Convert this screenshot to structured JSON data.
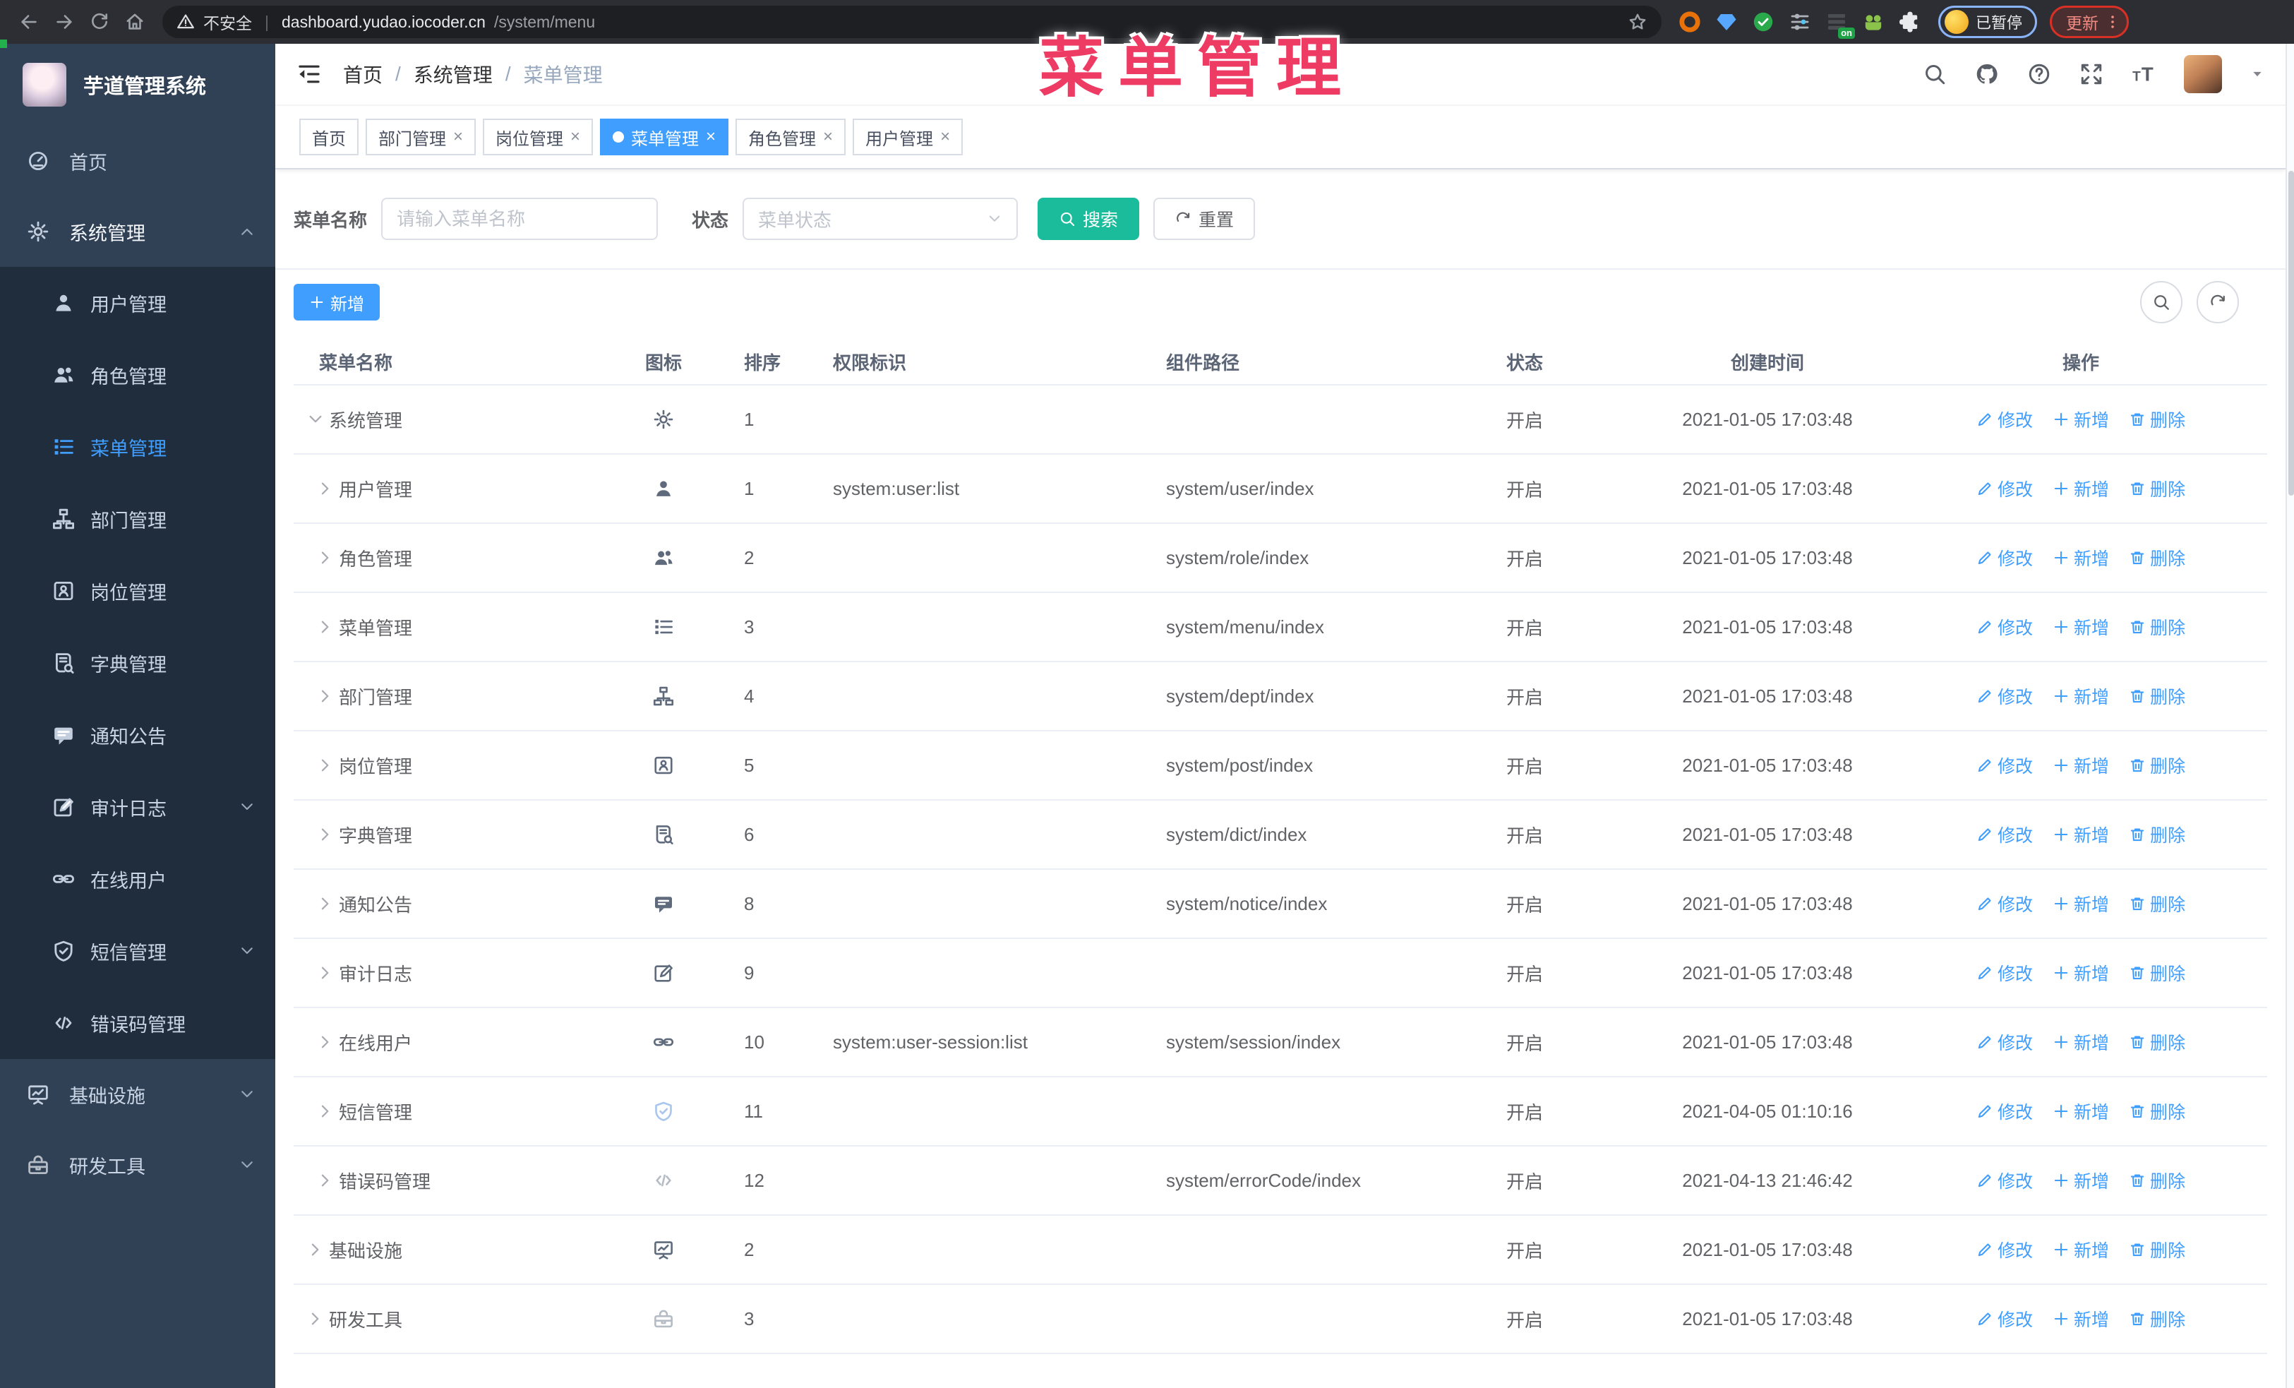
{
  "colors": {
    "accent": "#409eff",
    "search_button": "#1abc9c",
    "sidebar_bg": "#304156",
    "submenu_bg": "#1f2d3d",
    "overlay_title": "#ee3b63"
  },
  "browser": {
    "security_label": "不安全",
    "url_host": "dashboard.yudao.iocoder.cn",
    "url_path": "/system/menu",
    "extension_badge": "on",
    "profile_badge": "已暂停",
    "update_label": "更新",
    "extensions": [
      {
        "name": "ext-ring-icon",
        "color": "#e8710a"
      },
      {
        "name": "ext-gem-icon",
        "color": "#57a6ff"
      },
      {
        "name": "ext-check-circle-icon",
        "color": "#2aa84c"
      },
      {
        "name": "ext-sliders-icon",
        "color": "#aeb3bb"
      },
      {
        "name": "ext-rows-icon",
        "color": "#4a4d52",
        "badge": "on"
      },
      {
        "name": "ext-frog-icon",
        "color": "#8bc34a"
      },
      {
        "name": "ext-puzzle-icon",
        "color": "#e8eaed"
      }
    ]
  },
  "overlay": {
    "title": "菜单管理"
  },
  "sidebar": {
    "logo_title": "芋道管理系统",
    "menu": [
      {
        "label": "首页",
        "icon": "dashboard-icon",
        "level": 0
      },
      {
        "label": "系统管理",
        "icon": "gear-icon",
        "level": 0,
        "chevron": "up",
        "parent_active": true
      },
      {
        "label": "用户管理",
        "icon": "user-icon",
        "sub": true
      },
      {
        "label": "角色管理",
        "icon": "users-icon",
        "sub": true
      },
      {
        "label": "菜单管理",
        "icon": "menu-list-icon",
        "sub": true,
        "active": true
      },
      {
        "label": "部门管理",
        "icon": "org-tree-icon",
        "sub": true
      },
      {
        "label": "岗位管理",
        "icon": "badge-icon",
        "sub": true
      },
      {
        "label": "字典管理",
        "icon": "dict-book-icon",
        "sub": true
      },
      {
        "label": "通知公告",
        "icon": "announcement-icon",
        "sub": true
      },
      {
        "label": "审计日志",
        "icon": "audit-log-icon",
        "sub": true,
        "chevron": "down"
      },
      {
        "label": "在线用户",
        "icon": "online-link-icon",
        "sub": true
      },
      {
        "label": "短信管理",
        "icon": "shield-icon",
        "sub": true,
        "chevron": "down"
      },
      {
        "label": "错误码管理",
        "icon": "code-icon",
        "sub": true
      },
      {
        "label": "基础设施",
        "icon": "monitor-icon",
        "level": 0,
        "chevron": "down"
      },
      {
        "label": "研发工具",
        "icon": "toolbox-icon",
        "level": 0,
        "chevron": "down",
        "iconColor": "#b6bcc6"
      }
    ]
  },
  "header": {
    "breadcrumb": [
      "首页",
      "系统管理",
      "菜单管理"
    ],
    "icons": [
      "search-icon",
      "github-icon",
      "help-icon",
      "fullscreen-icon",
      "font-size-icon"
    ]
  },
  "tags": [
    {
      "label": "首页",
      "closable": false,
      "active": false
    },
    {
      "label": "部门管理",
      "closable": true,
      "active": false
    },
    {
      "label": "岗位管理",
      "closable": true,
      "active": false
    },
    {
      "label": "菜单管理",
      "closable": true,
      "active": true
    },
    {
      "label": "角色管理",
      "closable": true,
      "active": false
    },
    {
      "label": "用户管理",
      "closable": true,
      "active": false
    }
  ],
  "filters": {
    "name_label": "菜单名称",
    "name_placeholder": "请输入菜单名称",
    "status_label": "状态",
    "status_placeholder": "菜单状态",
    "search_label": "搜索",
    "reset_label": "重置"
  },
  "toolbar": {
    "add_label": "新增"
  },
  "table": {
    "columns": [
      "菜单名称",
      "图标",
      "排序",
      "权限标识",
      "组件路径",
      "状态",
      "创建时间",
      "操作"
    ],
    "actions": [
      {
        "label": "修改",
        "icon": "edit-pencil-icon"
      },
      {
        "label": "新增",
        "icon": "plus-icon"
      },
      {
        "label": "删除",
        "icon": "trash-icon"
      }
    ],
    "rows": [
      {
        "name": "系统管理",
        "level": 0,
        "expanded": true,
        "icon": "gear-icon",
        "order": "1",
        "perms": "",
        "path": "",
        "status": "开启",
        "time": "2021-01-05 17:03:48"
      },
      {
        "name": "用户管理",
        "level": 1,
        "icon": "user-icon",
        "order": "1",
        "perms": "system:user:list",
        "path": "system/user/index",
        "status": "开启",
        "time": "2021-01-05 17:03:48"
      },
      {
        "name": "角色管理",
        "level": 1,
        "icon": "users-icon",
        "order": "2",
        "perms": "",
        "path": "system/role/index",
        "status": "开启",
        "time": "2021-01-05 17:03:48"
      },
      {
        "name": "菜单管理",
        "level": 1,
        "icon": "menu-list-icon",
        "order": "3",
        "perms": "",
        "path": "system/menu/index",
        "status": "开启",
        "time": "2021-01-05 17:03:48"
      },
      {
        "name": "部门管理",
        "level": 1,
        "icon": "org-tree-icon",
        "order": "4",
        "perms": "",
        "path": "system/dept/index",
        "status": "开启",
        "time": "2021-01-05 17:03:48"
      },
      {
        "name": "岗位管理",
        "level": 1,
        "icon": "badge-icon",
        "order": "5",
        "perms": "",
        "path": "system/post/index",
        "status": "开启",
        "time": "2021-01-05 17:03:48"
      },
      {
        "name": "字典管理",
        "level": 1,
        "icon": "dict-book-icon",
        "order": "6",
        "perms": "",
        "path": "system/dict/index",
        "status": "开启",
        "time": "2021-01-05 17:03:48"
      },
      {
        "name": "通知公告",
        "level": 1,
        "icon": "announcement-icon",
        "order": "8",
        "perms": "",
        "path": "system/notice/index",
        "status": "开启",
        "time": "2021-01-05 17:03:48"
      },
      {
        "name": "审计日志",
        "level": 1,
        "icon": "audit-log-icon",
        "order": "9",
        "perms": "",
        "path": "",
        "status": "开启",
        "time": "2021-01-05 17:03:48"
      },
      {
        "name": "在线用户",
        "level": 1,
        "icon": "online-link-icon",
        "order": "10",
        "perms": "system:user-session:list",
        "path": "system/session/index",
        "status": "开启",
        "time": "2021-01-05 17:03:48"
      },
      {
        "name": "短信管理",
        "level": 1,
        "icon": "shield-icon",
        "iconColor": "#a9c6ee",
        "order": "11",
        "perms": "",
        "path": "",
        "status": "开启",
        "time": "2021-04-05 01:10:16"
      },
      {
        "name": "错误码管理",
        "level": 1,
        "icon": "code-icon",
        "iconColor": "#b6bcc6",
        "order": "12",
        "perms": "",
        "path": "system/errorCode/index",
        "status": "开启",
        "time": "2021-04-13 21:46:42"
      },
      {
        "name": "基础设施",
        "level": 0,
        "icon": "monitor-icon",
        "order": "2",
        "perms": "",
        "path": "",
        "status": "开启",
        "time": "2021-01-05 17:03:48"
      },
      {
        "name": "研发工具",
        "level": 0,
        "icon": "toolbox-icon",
        "iconColor": "#b6bcc6",
        "order": "3",
        "perms": "",
        "path": "",
        "status": "开启",
        "time": "2021-01-05 17:03:48"
      }
    ]
  }
}
